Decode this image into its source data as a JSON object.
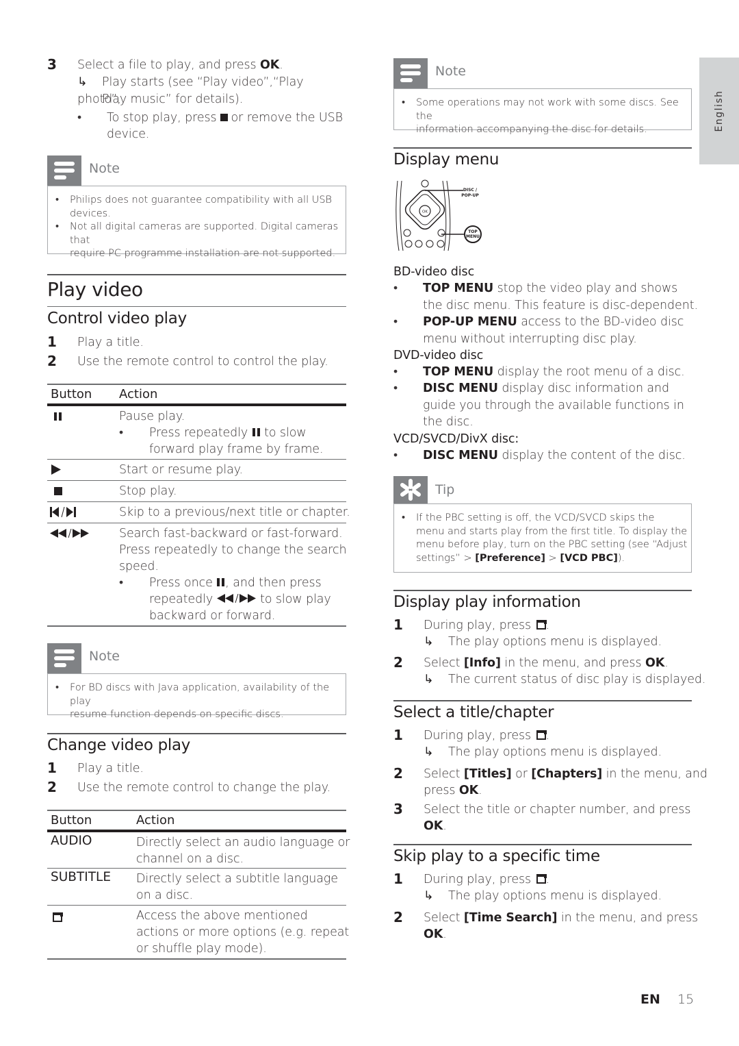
{
  "left": {
    "step3": {
      "num": "3",
      "text_pre": "Select a file to play, and press ",
      "text_bold": "OK",
      "text_post": ".",
      "result_line1": "Play starts (see “Play video”,“Play photo”,",
      "result_line2": "Play music” for details).",
      "bullet_pre": "To stop play, press",
      "bullet_post": "or remove the USB",
      "bullet_line2": "device."
    },
    "note1": {
      "title": "Note",
      "items": [
        {
          "line1": "Philips does not guarantee compatibility with all USB",
          "line2": "devices."
        },
        {
          "line1": "Not all digital cameras are supported. Digital cameras that",
          "line2": "require PC programme installation are not supported."
        }
      ]
    },
    "play_video_title": "Play video",
    "control": {
      "title": "Control video play",
      "steps": [
        {
          "num": "1",
          "text": "Play a title."
        },
        {
          "num": "2",
          "text": "Use the remote control to control the play."
        }
      ],
      "table": {
        "headers": [
          "Button",
          "Action"
        ],
        "rows": [
          {
            "icon": "pause-icon",
            "glyph": "❚❚",
            "lines": [
              "Pause play."
            ],
            "sub_bullet": [
              "Press repeatedly",
              "to slow",
              "forward play frame by frame."
            ]
          },
          {
            "icon": "play-icon",
            "glyph": "▶",
            "lines": [
              "Start or resume play."
            ]
          },
          {
            "icon": "stop-icon",
            "glyph": "■",
            "lines": [
              "Stop play."
            ]
          },
          {
            "icon": "skip-prev-next-icon",
            "glyph": "▏◀/▶▕",
            "lines": [
              "Skip to a previous/next title or chapter."
            ]
          },
          {
            "icon": "rewind-forward-icon",
            "glyph": "◀◀/▶▶",
            "lines": [
              "Search fast-backward or fast-forward.",
              "Press repeatedly to change the search",
              "speed."
            ],
            "sub_bullet": [
              "Press once",
              ", and then press",
              "repeatedly",
              "to slow play",
              "backward or forward."
            ]
          }
        ]
      }
    },
    "note2": {
      "title": "Note",
      "items": [
        {
          "line1": "For BD discs with Java application, availability of the play",
          "line2": "resume function depends on specific discs."
        }
      ]
    },
    "change": {
      "title": "Change video play",
      "steps": [
        {
          "num": "1",
          "text": "Play a title."
        },
        {
          "num": "2",
          "text": "Use the remote control to change the play."
        }
      ],
      "table": {
        "headers": [
          "Button",
          "Action"
        ],
        "rows": [
          {
            "button": "AUDIO",
            "lines": [
              "Directly select an audio language or",
              "channel on a disc."
            ]
          },
          {
            "button": "SUBTITLE",
            "lines": [
              "Directly select a subtitle language",
              "on a disc."
            ]
          },
          {
            "icon": "options-icon",
            "lines": [
              "Access the above mentioned",
              "actions or more options (e.g. repeat",
              "or shuffle play mode)."
            ]
          }
        ]
      }
    }
  },
  "right": {
    "note3": {
      "title": "Note",
      "items": [
        {
          "line1": "Some operations may not work with some discs. See the",
          "line2": "information accompanying the disc for details."
        }
      ]
    },
    "display_menu": {
      "title": "Display menu",
      "remote_labels": {
        "disc_popup_1": "DISC /",
        "disc_popup_2": "POP-UP",
        "top_menu_1": "TOP",
        "top_menu_2": "MENU",
        "ok": "OK"
      },
      "bd": {
        "heading": "BD-video disc",
        "items": [
          {
            "bold": "TOP MENU",
            "line1": " stop the video play and shows",
            "line2": "the disc menu. This feature is disc-dependent."
          },
          {
            "bold": "POP-UP MENU",
            "line1": " access to the BD-video disc",
            "line2": "menu without interrupting disc play."
          }
        ]
      },
      "dvd": {
        "heading": "DVD-video disc",
        "items": [
          {
            "bold": "TOP MENU",
            "line1": " display the root menu of a disc."
          },
          {
            "bold": "DISC MENU",
            "line1": " display disc information and",
            "line2": "guide you through the available functions in",
            "line3": "the disc."
          }
        ]
      },
      "vcd": {
        "heading": "VCD/SVCD/DivX disc:",
        "items": [
          {
            "bold": "DISC MENU",
            "line1": " display the content of the disc."
          }
        ]
      }
    },
    "tip": {
      "title": "Tip",
      "line1": "If the PBC setting is off, the VCD/SVCD skips the",
      "line2": "menu and starts play from the first title. To display the",
      "line3": "menu before play, turn on the PBC setting (see “Adjust",
      "line4_pre": "settings” > ",
      "line4_b1": "[Preference]",
      "line4_mid": " > ",
      "line4_b2": "[VCD PBC]",
      "line4_post": ")."
    },
    "play_info": {
      "title": "Display play information",
      "step1": {
        "num": "1",
        "text": "During play, press",
        "result": "The play options menu is displayed."
      },
      "step2": {
        "num": "2",
        "pre": "Select ",
        "bold": "[Info]",
        "mid": " in the menu, and press ",
        "bold2": "OK",
        "post": ".",
        "result": "The current status of disc play is displayed."
      }
    },
    "title_chapter": {
      "title": "Select a title/chapter",
      "step1": {
        "num": "1",
        "text": "During play, press",
        "result": "The play options menu is displayed."
      },
      "step2": {
        "num": "2",
        "pre": "Select ",
        "bold": "[Titles]",
        "mid": " or ",
        "bold2": "[Chapters]",
        "post": " in the menu, and",
        "line2_pre": "press ",
        "line2_bold": "OK",
        "line2_post": "."
      },
      "step3": {
        "num": "3",
        "text": "Select the title or chapter number, and press",
        "line2_bold": "OK",
        "line2_post": "."
      }
    },
    "skip_time": {
      "title": "Skip play to a specific time",
      "step1": {
        "num": "1",
        "text": "During play, press",
        "result": "The play options menu is displayed."
      },
      "step2": {
        "num": "2",
        "pre": "Select ",
        "bold": "[Time Search]",
        "post": " in the menu, and press",
        "line2_bold": "OK",
        "line2_post": "."
      }
    }
  },
  "side_tab": "English",
  "footer": {
    "lang": "EN",
    "page": "15"
  },
  "glyphs": {
    "result_arrow": "↳",
    "bullet": "•"
  }
}
